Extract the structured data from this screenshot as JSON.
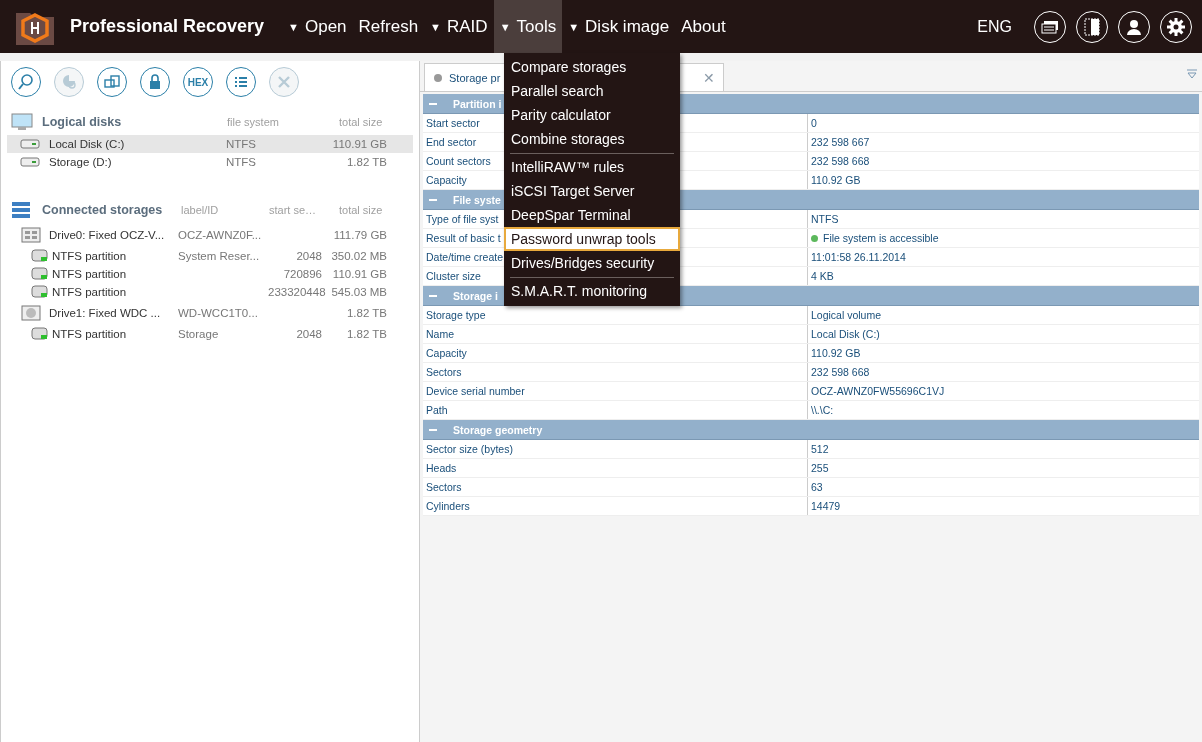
{
  "app": {
    "title": "Professional Recovery",
    "language": "ENG"
  },
  "menu": [
    {
      "label": "Open",
      "caret": "▼",
      "selected": false
    },
    {
      "label": "Refresh",
      "selected": false
    },
    {
      "label": "RAID",
      "caret": "▼",
      "selected": false
    },
    {
      "label": "Tools",
      "caret": "▼",
      "selected": true
    },
    {
      "label": "Disk image",
      "caret": "▼",
      "selected": false
    },
    {
      "label": "About",
      "selected": false
    }
  ],
  "dropdown": [
    {
      "label": "Compare storages",
      "separator_before": false,
      "highlighted": false
    },
    {
      "label": "Parallel search",
      "separator_before": false,
      "highlighted": false
    },
    {
      "label": "Parity calculator",
      "separator_before": false,
      "highlighted": false
    },
    {
      "label": "Combine storages",
      "separator_before": false,
      "highlighted": false
    },
    {
      "label": "IntelliRAW™ rules",
      "separator_before": true,
      "highlighted": false
    },
    {
      "label": "iSCSI Target Server",
      "separator_before": false,
      "highlighted": false
    },
    {
      "label": "DeepSpar Terminal",
      "separator_before": false,
      "highlighted": false
    },
    {
      "label": "Password unwrap tools",
      "separator_before": false,
      "highlighted": true
    },
    {
      "label": "Drives/Bridges security",
      "separator_before": false,
      "highlighted": false
    },
    {
      "label": "S.M.A.R.T. monitoring",
      "separator_before": true,
      "highlighted": false
    }
  ],
  "toolbar": [
    {
      "kind": "scan",
      "disabled": false
    },
    {
      "kind": "chart",
      "disabled": true
    },
    {
      "kind": "copy",
      "disabled": false
    },
    {
      "kind": "lock",
      "disabled": false
    },
    {
      "kind": "hex",
      "label": "HEX",
      "disabled": false
    },
    {
      "kind": "list",
      "disabled": false
    },
    {
      "kind": "close",
      "disabled": true
    }
  ],
  "logical_disks": {
    "title": "Logical disks",
    "columns": [
      "file system",
      "total size"
    ],
    "rows": [
      {
        "name": "Local Disk (C:)",
        "file_system": "NTFS",
        "size": "110.91 GB",
        "selected": true
      },
      {
        "name": "Storage (D:)",
        "file_system": "NTFS",
        "size": "1.82 TB",
        "selected": false
      }
    ]
  },
  "connected_storages": {
    "title": "Connected storages",
    "columns": [
      "label/ID",
      "start se…",
      "total size"
    ],
    "drives": [
      {
        "name": "Drive0: Fixed OCZ-V...",
        "kind": "ssd",
        "label": "OCZ-AWNZ0F...",
        "size": "111.79 GB",
        "children": [
          {
            "name": "NTFS partition",
            "label": "System Reser...",
            "start": "2048",
            "size": "350.02 MB"
          },
          {
            "name": "NTFS partition",
            "start": "720896",
            "size": "110.91 GB"
          },
          {
            "name": "NTFS partition",
            "start": "233320448",
            "size": "545.03 MB"
          }
        ]
      },
      {
        "name": "Drive1: Fixed WDC ...",
        "kind": "hdd",
        "label": "WD-WCC1T0...",
        "size": "1.82 TB",
        "children": [
          {
            "name": "NTFS partition",
            "label": "Storage",
            "start": "2048",
            "size": "1.82 TB"
          }
        ]
      }
    ]
  },
  "tab": {
    "title": "Storage pr",
    "close": "✕"
  },
  "properties": [
    {
      "title": "Partition i",
      "expanded": true,
      "rows": [
        {
          "name": "Start sector",
          "value": "0"
        },
        {
          "name": "End sector",
          "value": "232 598 667"
        },
        {
          "name": "Count sectors",
          "value": "232 598 668"
        },
        {
          "name": "Capacity",
          "value": "110.92 GB"
        }
      ]
    },
    {
      "title": "File syste",
      "expanded": true,
      "rows": [
        {
          "name": "Type of file syst",
          "value": "NTFS"
        },
        {
          "name": "Result of basic t",
          "value": "File system is accessible",
          "color": "#5cb85c"
        },
        {
          "name": "Date/time create",
          "value": "11:01:58 26.11.2014"
        },
        {
          "name": "Cluster size",
          "value": "4 KB"
        }
      ]
    },
    {
      "title": "Storage i",
      "expanded": true,
      "rows": [
        {
          "name": "Storage type",
          "value": "Logical volume"
        },
        {
          "name": "Name",
          "value": "Local Disk (C:)"
        },
        {
          "name": "Capacity",
          "value": "110.92 GB"
        },
        {
          "name": "Sectors",
          "value": "232 598 668"
        },
        {
          "name": "Device serial number",
          "value": "OCZ-AWNZ0FW55696C1VJ"
        },
        {
          "name": "Path",
          "value": "\\\\.\\C:"
        }
      ]
    },
    {
      "title": "Storage geometry",
      "expanded": true,
      "rows": [
        {
          "name": "Sector size (bytes)",
          "value": "512"
        },
        {
          "name": "Heads",
          "value": "255"
        },
        {
          "name": "Sectors",
          "value": "63"
        },
        {
          "name": "Cylinders",
          "value": "14479"
        }
      ]
    }
  ]
}
